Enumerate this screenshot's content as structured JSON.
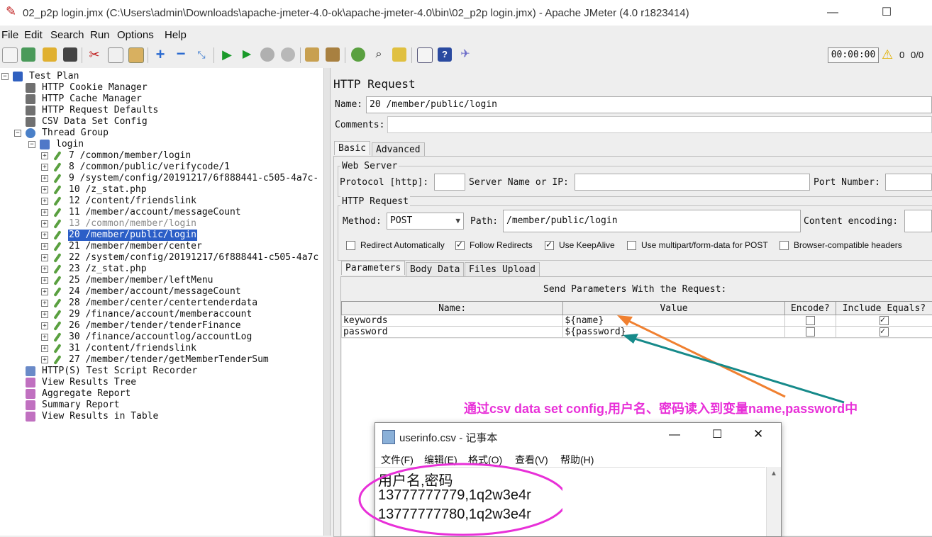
{
  "window": {
    "title": "02_p2p login.jmx (C:\\Users\\admin\\Downloads\\apache-jmeter-4.0-ok\\apache-jmeter-4.0\\bin\\02_p2p login.jmx) - Apache JMeter (4.0 r1823414)",
    "minimize": "—",
    "maximize": "☐",
    "close": "✕"
  },
  "menu": [
    "File",
    "Edit",
    "Search",
    "Run",
    "Options",
    "Help"
  ],
  "toolbar": {
    "timer": "00:00:00",
    "warnings": "0",
    "threads": "0/0",
    "icons": [
      "new-icon",
      "templates-icon",
      "open-icon",
      "save-icon",
      "cut-icon",
      "copy-icon",
      "paste-icon",
      "expand-icon",
      "collapse-icon",
      "toggle-icon",
      "start-icon",
      "start-no-pause-icon",
      "stop-icon",
      "shutdown-icon",
      "clear-icon",
      "clear-all-icon",
      "search-icon",
      "reset-search-icon",
      "function-helper-icon",
      "help-icon",
      "remote-icon"
    ]
  },
  "tree": [
    {
      "label": "Test Plan",
      "depth": 0,
      "icon": "test-plan-icon",
      "expander": "minus"
    },
    {
      "label": "HTTP Cookie Manager",
      "depth": 1,
      "icon": "config-icon"
    },
    {
      "label": "HTTP Cache Manager",
      "depth": 1,
      "icon": "config-icon"
    },
    {
      "label": "HTTP Request Defaults",
      "depth": 1,
      "icon": "config-icon"
    },
    {
      "label": "CSV Data Set Config",
      "depth": 1,
      "icon": "config-icon"
    },
    {
      "label": "Thread Group",
      "depth": 1,
      "icon": "thread-group-icon",
      "expander": "minus"
    },
    {
      "label": "login",
      "depth": 2,
      "icon": "controller-icon",
      "expander": "minus"
    },
    {
      "label": "7 /common/member/login",
      "depth": 3,
      "icon": "sampler-icon",
      "expander": "plus"
    },
    {
      "label": "8 /common/public/verifycode/1",
      "depth": 3,
      "icon": "sampler-icon",
      "expander": "plus"
    },
    {
      "label": "9 /system/config/20191217/6f888441-c505-4a7c-",
      "depth": 3,
      "icon": "sampler-icon",
      "expander": "plus"
    },
    {
      "label": "10 /z_stat.php",
      "depth": 3,
      "icon": "sampler-icon",
      "expander": "plus"
    },
    {
      "label": "12 /content/friendslink",
      "depth": 3,
      "icon": "sampler-icon",
      "expander": "plus"
    },
    {
      "label": "11 /member/account/messageCount",
      "depth": 3,
      "icon": "sampler-icon",
      "expander": "plus"
    },
    {
      "label": "13 /common/member/login",
      "depth": 3,
      "icon": "sampler-icon",
      "expander": "plus",
      "disabled": true
    },
    {
      "label": "20 /member/public/login",
      "depth": 3,
      "icon": "sampler-icon",
      "expander": "plus",
      "selected": true
    },
    {
      "label": "21 /member/member/center",
      "depth": 3,
      "icon": "sampler-icon",
      "expander": "plus"
    },
    {
      "label": "22 /system/config/20191217/6f888441-c505-4a7c",
      "depth": 3,
      "icon": "sampler-icon",
      "expander": "plus"
    },
    {
      "label": "23 /z_stat.php",
      "depth": 3,
      "icon": "sampler-icon",
      "expander": "plus"
    },
    {
      "label": "25 /member/member/leftMenu",
      "depth": 3,
      "icon": "sampler-icon",
      "expander": "plus"
    },
    {
      "label": "24 /member/account/messageCount",
      "depth": 3,
      "icon": "sampler-icon",
      "expander": "plus"
    },
    {
      "label": "28 /member/center/centertenderdata",
      "depth": 3,
      "icon": "sampler-icon",
      "expander": "plus"
    },
    {
      "label": "29 /finance/account/memberaccount",
      "depth": 3,
      "icon": "sampler-icon",
      "expander": "plus"
    },
    {
      "label": "26 /member/tender/tenderFinance",
      "depth": 3,
      "icon": "sampler-icon",
      "expander": "plus"
    },
    {
      "label": "30 /finance/accountlog/accountLog",
      "depth": 3,
      "icon": "sampler-icon",
      "expander": "plus"
    },
    {
      "label": "31 /content/friendslink",
      "depth": 3,
      "icon": "sampler-icon",
      "expander": "plus"
    },
    {
      "label": "27 /member/tender/getMemberTenderSum",
      "depth": 3,
      "icon": "sampler-icon",
      "expander": "plus"
    },
    {
      "label": "HTTP(S) Test Script Recorder",
      "depth": 1,
      "icon": "recorder-icon"
    },
    {
      "label": "View Results Tree",
      "depth": 1,
      "icon": "listener-icon"
    },
    {
      "label": "Aggregate Report",
      "depth": 1,
      "icon": "listener-icon"
    },
    {
      "label": "Summary Report",
      "depth": 1,
      "icon": "listener-icon"
    },
    {
      "label": "View Results in Table",
      "depth": 1,
      "icon": "listener-icon"
    }
  ],
  "panel": {
    "title": "HTTP Request",
    "name_label": "Name:",
    "name_value": "20 /member/public/login",
    "comments_label": "Comments:",
    "tabs": [
      "Basic",
      "Advanced"
    ],
    "web_server": {
      "legend": "Web Server",
      "protocol_label": "Protocol [http]:",
      "server_label": "Server Name or IP:",
      "port_label": "Port Number:"
    },
    "http_request": {
      "legend": "HTTP Request",
      "method_label": "Method:",
      "method_value": "POST",
      "path_label": "Path:",
      "path_value": "/member/public/login",
      "encoding_label": "Content encoding:"
    },
    "options": [
      {
        "label": "Redirect Automatically",
        "checked": false
      },
      {
        "label": "Follow Redirects",
        "checked": true
      },
      {
        "label": "Use KeepAlive",
        "checked": true
      },
      {
        "label": "Use multipart/form-data for POST",
        "checked": false
      },
      {
        "label": "Browser-compatible headers",
        "checked": false
      }
    ],
    "subtabs": [
      "Parameters",
      "Body Data",
      "Files Upload"
    ],
    "params_caption": "Send Parameters With the Request:",
    "columns": [
      "Name:",
      "Value",
      "Encode?",
      "Include Equals?"
    ],
    "rows": [
      {
        "name": "keywords",
        "value": "${name}",
        "encode": false,
        "include_equals": true
      },
      {
        "name": "password",
        "value": "${password}",
        "encode": false,
        "include_equals": true
      }
    ]
  },
  "annotation": {
    "text": "通过csv data set config,用户名、密码读入到变量name,password中",
    "color": "#e830d8"
  },
  "notepad": {
    "title": "userinfo.csv - 记事本",
    "menu": [
      "文件(F)",
      "编辑(E)",
      "格式(O)",
      "查看(V)",
      "帮助(H)"
    ],
    "lines": [
      "用户名,密码",
      "13777777779,1q2w3e4r",
      "13777777780,1q2w3e4r"
    ]
  },
  "colors": {
    "selection": "#2b5ec7",
    "arrow_orange": "#f08030",
    "arrow_teal": "#168a8a",
    "ellipse": "#e830d8"
  }
}
